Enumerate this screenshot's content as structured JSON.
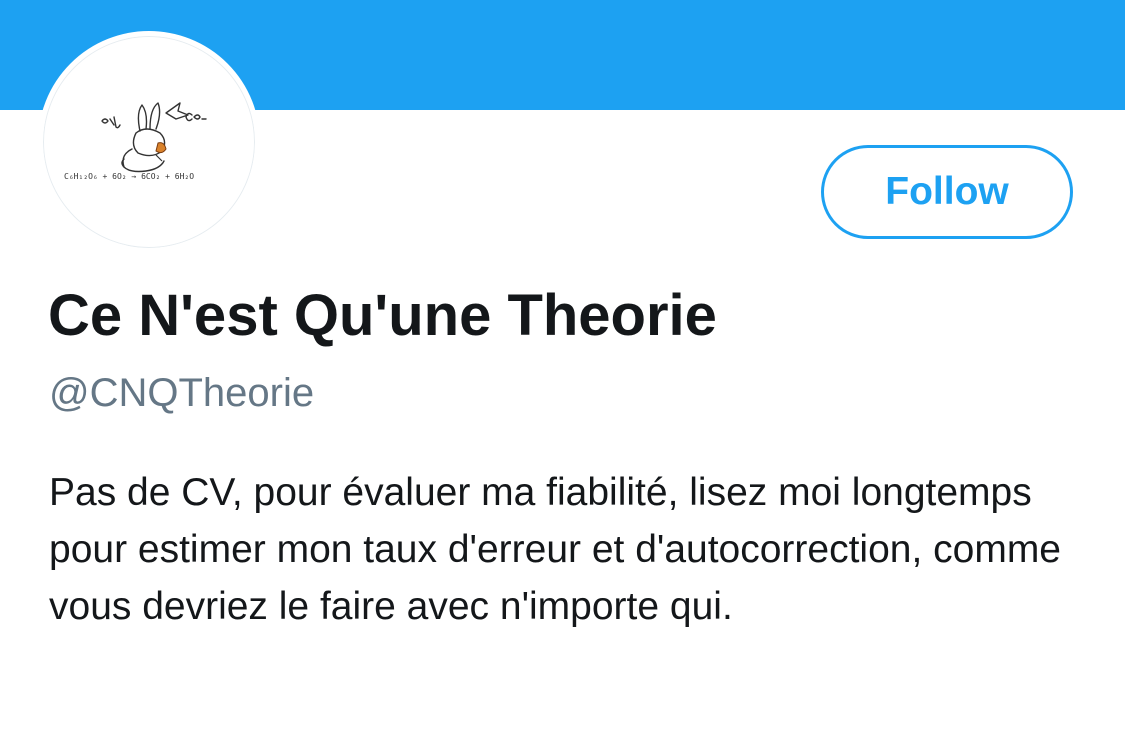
{
  "colors": {
    "banner": "#1da1f2",
    "accent": "#1da1f2",
    "name_text": "#14171a",
    "handle_text": "#657786",
    "bio_text": "#14171a"
  },
  "profile": {
    "avatar_icon": "rabbit-sketch-photosynthesis-equation-avatar",
    "display_name": "Ce N'est Qu'une Theorie",
    "handle": "@CNQTheorie",
    "bio": "Pas de CV, pour évaluer ma fiabilité, lisez moi longtemps pour estimer mon taux d'erreur et d'autocorrection, comme vous devriez le faire avec n'importe qui."
  },
  "actions": {
    "follow_label": "Follow"
  }
}
